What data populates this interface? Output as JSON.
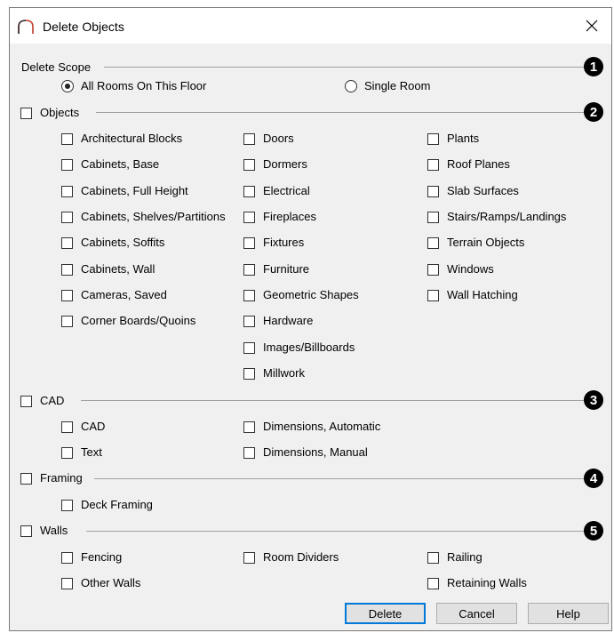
{
  "window": {
    "title": "Delete Objects"
  },
  "scope": {
    "label": "Delete Scope",
    "options": [
      {
        "label": "All Rooms On This Floor",
        "checked": true
      },
      {
        "label": "Single Room",
        "checked": false
      }
    ]
  },
  "badges": [
    "1",
    "2",
    "3",
    "4",
    "5"
  ],
  "objects": {
    "label": "Objects",
    "col1": [
      "Architectural Blocks",
      "Cabinets, Base",
      "Cabinets, Full Height",
      "Cabinets, Shelves/Partitions",
      "Cabinets, Soffits",
      "Cabinets, Wall",
      "Cameras, Saved",
      "Corner Boards/Quoins"
    ],
    "col2": [
      "Doors",
      "Dormers",
      "Electrical",
      "Fireplaces",
      "Fixtures",
      "Furniture",
      "Geometric Shapes",
      "Hardware",
      "Images/Billboards",
      "Millwork"
    ],
    "col3": [
      "Plants",
      "Roof Planes",
      "Slab Surfaces",
      "Stairs/Ramps/Landings",
      "Terrain Objects",
      "Windows",
      "Wall Hatching"
    ]
  },
  "cad": {
    "label": "CAD",
    "col1": [
      "CAD",
      "Text"
    ],
    "col2": [
      "Dimensions, Automatic",
      "Dimensions, Manual"
    ]
  },
  "framing": {
    "label": "Framing",
    "col1": [
      "Deck Framing"
    ]
  },
  "walls": {
    "label": "Walls",
    "col1": [
      "Fencing",
      "Other Walls"
    ],
    "col2": [
      "Room Dividers"
    ],
    "col3": [
      "Railing",
      "Retaining Walls"
    ]
  },
  "buttons": {
    "delete": "Delete",
    "cancel": "Cancel",
    "help": "Help"
  }
}
